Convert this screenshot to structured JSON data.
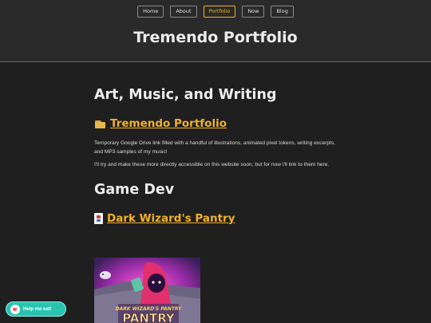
{
  "nav": {
    "items": [
      {
        "label": "Home"
      },
      {
        "label": "About"
      },
      {
        "label": "Portfolio",
        "active": true
      },
      {
        "label": "Now"
      },
      {
        "label": "Blog"
      }
    ]
  },
  "header": {
    "title": "Tremendo Portfolio"
  },
  "sections": {
    "art": {
      "heading": "Art, Music, and Writing",
      "link_label": "Tremendo Portfolio",
      "link_icon": "folder-icon",
      "paragraph1": "Temporary Google Drive link filled with a handful of illustrations, animated pixel tokens, writing excerpts, and MP3 samples of my music!",
      "paragraph2": "I'll try and make these more directly accessible on this website soon, but for now I'll link to them here."
    },
    "gamedev": {
      "heading": "Game Dev",
      "link_label": "Dark Wizard's Pantry",
      "link_icon": "playing-card-icon",
      "image_title": "DARK WIZARD'S PANTRY"
    }
  },
  "kofi": {
    "label": "Help me eat!"
  },
  "colors": {
    "accent": "#f2b227",
    "background": "#1f1f1f",
    "header_bg": "#2a2a2a",
    "kofi": "#29c4b0"
  }
}
